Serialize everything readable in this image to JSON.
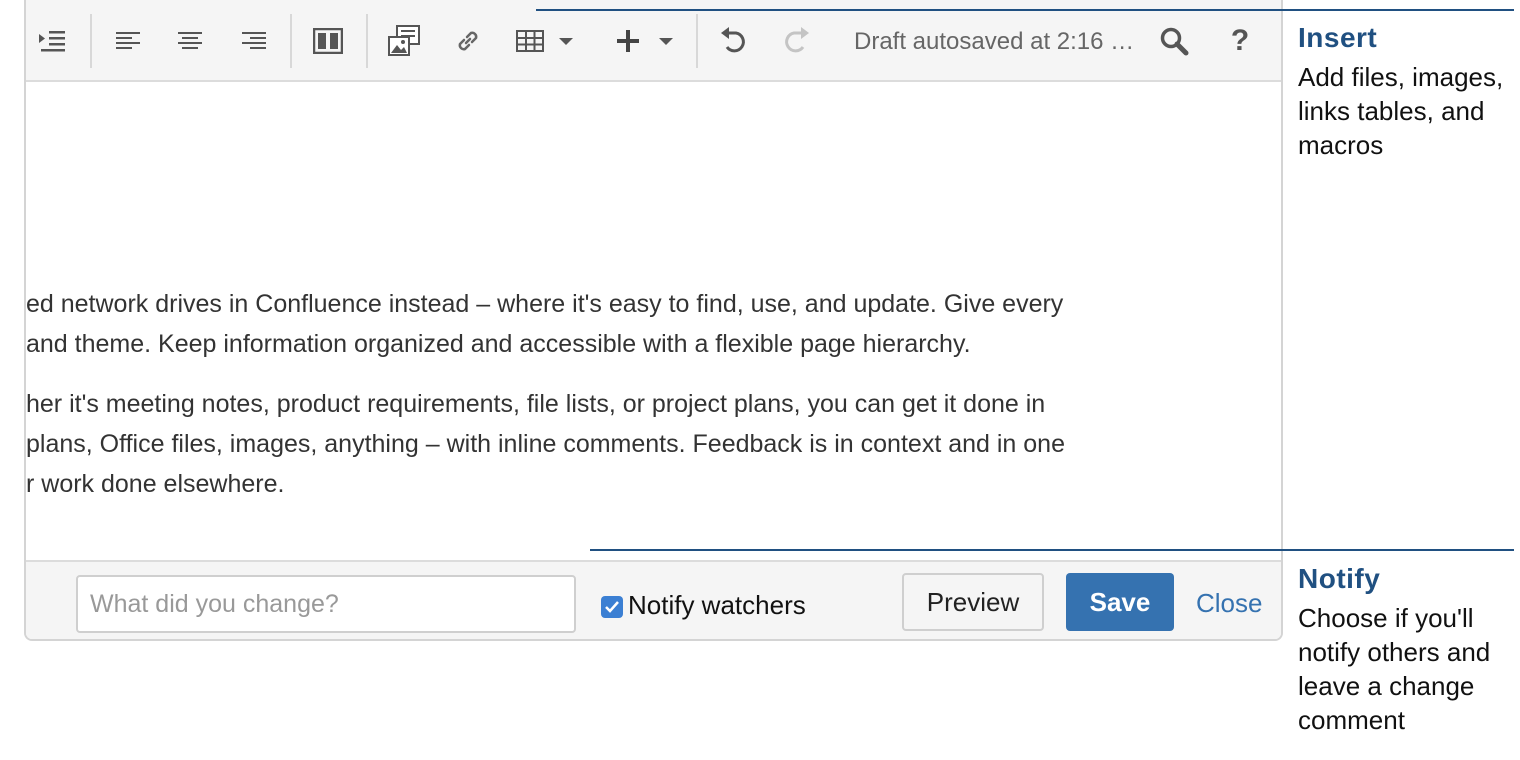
{
  "toolbar": {
    "autosave_text": "Draft autosaved at 2:16 …"
  },
  "content": {
    "lines": [
      "ed network drives in Confluence instead – where it's easy to find, use, and update. Give every",
      "and theme. Keep information organized and accessible with a flexible page hierarchy.",
      "her it's meeting notes, product requirements, file lists, or project plans, you can get it done in",
      "plans, Office files, images, anything – with inline comments. Feedback is in context and in one",
      "r work done elsewhere."
    ]
  },
  "footer": {
    "change_placeholder": "What did you change?",
    "notify_label": "Notify watchers",
    "notify_checked": true,
    "preview_label": "Preview",
    "save_label": "Save",
    "close_label": "Close"
  },
  "tips": {
    "insert": {
      "title": "Insert",
      "body": "Add files, images, links tables, and macros"
    },
    "notify": {
      "title": "Notify",
      "body": "Choose if you'll notify others and leave a change comment"
    }
  },
  "colors": {
    "accent": "#205081",
    "save_button": "#3572b0",
    "checkbox": "#3b7fd3"
  }
}
